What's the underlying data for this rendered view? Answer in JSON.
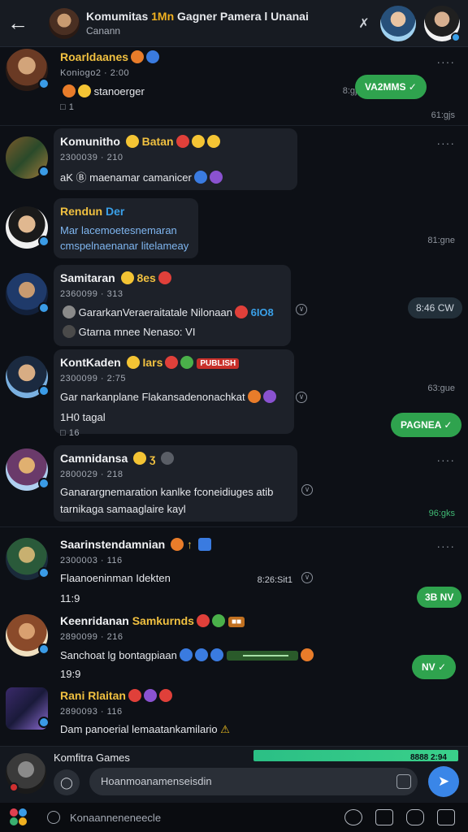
{
  "header": {
    "title_main": "Komumitas",
    "title_accent": "1Mn",
    "title_rest": "Gagner Pamera l Unanai",
    "subtitle": "Canann",
    "mute_icon": "mute-icon"
  },
  "messages": [
    {
      "name": "Roarldaanes",
      "meta": "Koniogo2 · 2:00",
      "text": "stanoerger",
      "time_right": "8:gjal",
      "reply_pill": "VA2MMS",
      "time_bottom": "61:gjs",
      "reactions": "1"
    },
    {
      "name": "Komunitho",
      "tag": "Batan",
      "meta": "2300039 · 210",
      "text": "aK Ⓑ maenamar camanicer",
      "time_bottom": "81:gne"
    },
    {
      "name": "Rendun",
      "tag": "Der",
      "text": "Mar lacemoetesnemaran",
      "text2": "cmspelnaenanar litelameay",
      "reply_pill": "8:46 CW"
    },
    {
      "name": "Samitaran",
      "tag": "8es",
      "meta": "2360099 · 313",
      "text": "GararkanVeraeraitatale Nilonaan",
      "tag2": "6IO8",
      "text2": "Gtarna mnee Nenaso: VI",
      "time_bottom": "63:gue"
    },
    {
      "name": "KontKaden",
      "tag": "Iars",
      "badge": "PUBLISH",
      "meta": "2300099 · 2:75",
      "text": "Gar narkanplane Flakansadenonachkat",
      "text2": "1H0 tagal",
      "reactions": "16",
      "reply_pill": "PAGNEA"
    },
    {
      "name": "Camnidansa",
      "tag": "ʒ",
      "meta": "2800029 · 218",
      "text": "Ganarargnemaration kanlke fconeidiuges atib",
      "text2": "tarnikaga samaaglaire kayl",
      "time_bottom": "96:gks"
    },
    {
      "name": "Saarinstendamnian",
      "meta": "2300003 · 116",
      "text": "Flaanoeninman Idekten",
      "time_mid": "8:26:Sit1",
      "text2": "11:9",
      "reply_pill": "3B NV"
    },
    {
      "name": "Keenridanan",
      "tag": "Samkurnds",
      "meta": "2890099 · 216",
      "text": "Sanchoat lg bontagpiaan",
      "text2": "19:9",
      "reply_pill": "NV"
    },
    {
      "name": "Rani",
      "tag": "Rlaitan",
      "meta": "2890093 · 116",
      "text": "Dam panoerial lemaatankamilario"
    }
  ],
  "composer": {
    "title": "Komfitra Games",
    "progress_label": "8888 2:94",
    "progress_value": 0.98,
    "placeholder": "Hoanmoanamenseisdin"
  },
  "navbar": {
    "search_text": "Konaanneneneecle"
  }
}
